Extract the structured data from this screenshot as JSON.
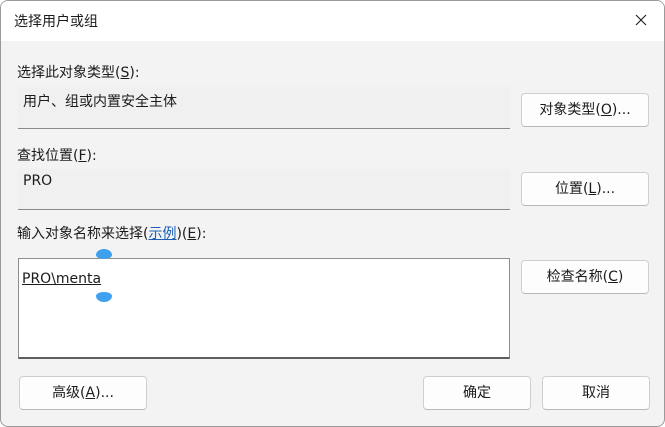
{
  "window": {
    "title": "选择用户或组",
    "close_icon": "close-icon"
  },
  "object_type": {
    "label_text": "选择此对象类型(",
    "label_key": "S",
    "label_suffix": "):",
    "value": "用户、组或内置安全主体",
    "button_text": "对象类型(",
    "button_key": "O",
    "button_suffix": ")..."
  },
  "location": {
    "label_text": "查找位置(",
    "label_key": "F",
    "label_suffix": "):",
    "value": "PRO",
    "button_text": "位置(",
    "button_key": "L",
    "button_suffix": ")..."
  },
  "names": {
    "label_text": "输入对象名称来选择(",
    "label_link": "示例",
    "label_mid": ")(",
    "label_key": "E",
    "label_suffix": "):",
    "entry": "PRO\\menta",
    "check_button_text": "检查名称(",
    "check_button_key": "C",
    "check_button_suffix": ")"
  },
  "footer": {
    "advanced_text": "高级(",
    "advanced_key": "A",
    "advanced_suffix": ")...",
    "ok_label": "确定",
    "cancel_label": "取消"
  }
}
